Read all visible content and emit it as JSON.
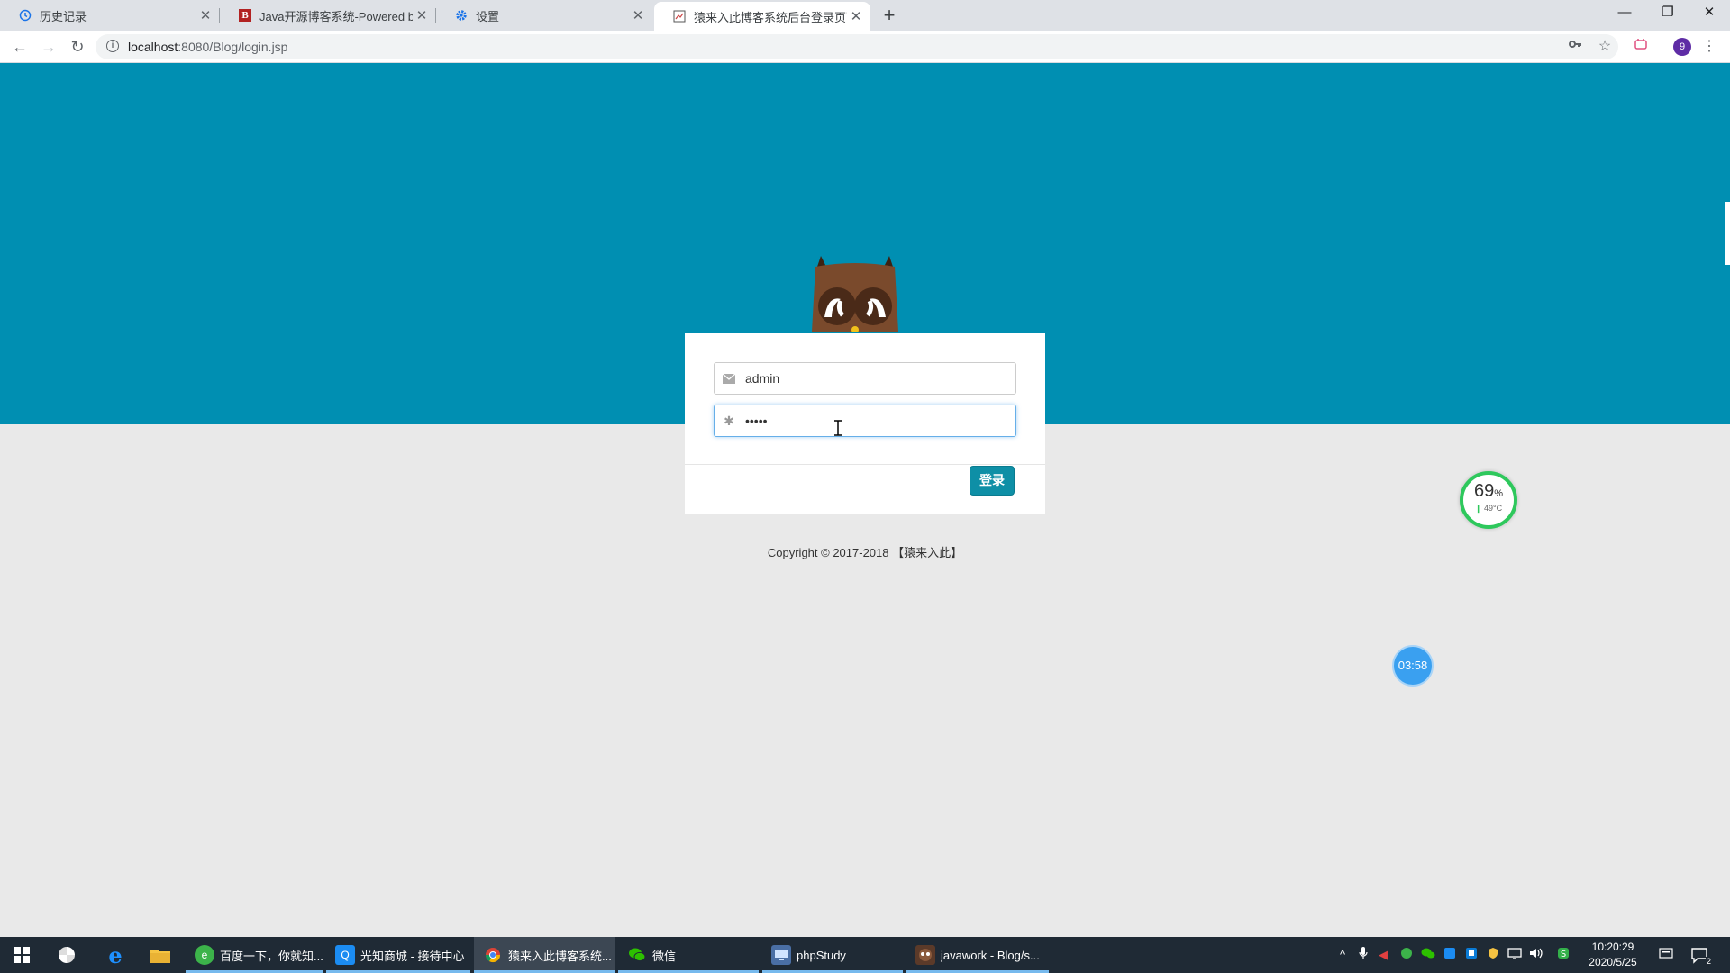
{
  "browser": {
    "tabs": [
      {
        "title": "历史记录",
        "icon": "history-icon"
      },
      {
        "title": "Java开源博客系统-Powered by",
        "icon": "b-logo-icon"
      },
      {
        "title": "设置",
        "icon": "gear-icon"
      },
      {
        "title": "猿来入此博客系统后台登录页面",
        "icon": "site-favicon",
        "active": true
      }
    ],
    "new_tab": "+",
    "window_controls": {
      "minimize": "—",
      "maximize": "❐",
      "close": "✕"
    },
    "url": {
      "host": "localhost",
      "rest": ":8080/Blog/login.jsp"
    },
    "profile_initial": "9"
  },
  "page": {
    "login": {
      "username_value": "admin",
      "password_value": "•••••",
      "submit_label": "登录"
    },
    "copyright": "Copyright © 2017-2018 【猿来入此】",
    "colors": {
      "banner": "#008fb2",
      "button": "#0e8fa6"
    }
  },
  "overlays": {
    "perf_percent": "69",
    "perf_percent_unit": "%",
    "perf_temp": "49°C",
    "timer": "03:58"
  },
  "taskbar": {
    "apps": [
      {
        "label": "百度一下，你就知...",
        "icon": "browser-360-icon"
      },
      {
        "label": "光知商城 - 接待中心",
        "icon": "chat-q-icon"
      },
      {
        "label": "猿来入此博客系统...",
        "icon": "chrome-icon",
        "active": true
      },
      {
        "label": "微信",
        "icon": "wechat-icon"
      },
      {
        "label": "phpStudy",
        "icon": "phpstudy-icon"
      },
      {
        "label": "javawork - Blog/s...",
        "icon": "eclipse-icon"
      }
    ],
    "clock": {
      "time": "10:20:29",
      "date": "2020/5/25"
    },
    "notification_count": "2"
  }
}
